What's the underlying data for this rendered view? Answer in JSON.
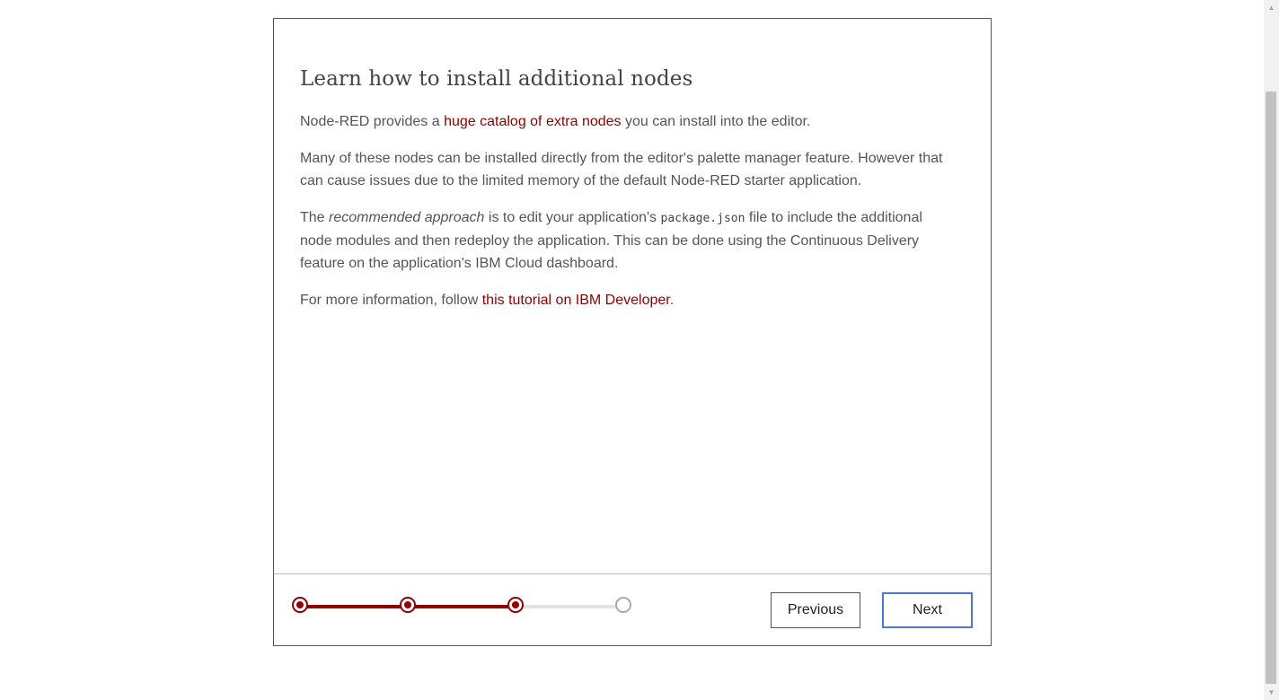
{
  "dialog": {
    "title": "Learn how to install additional nodes",
    "para1": {
      "before": "Node-RED provides a ",
      "link": "huge catalog of extra nodes",
      "after": " you can install into the editor."
    },
    "para2": "Many of these nodes can be installed directly from the editor's palette manager feature. However that can cause issues due to the limited memory of the default Node-RED starter application.",
    "para3": {
      "before": "The ",
      "emphasis": "recommended approach",
      "middle": " is to edit your application's ",
      "code": "package.json",
      "after": " file to include the additional node modules and then redeploy the application. This can be done using the Continuous Delivery feature on the application's IBM Cloud dashboard."
    },
    "para4": {
      "before": "For more information, follow ",
      "link": "this tutorial on IBM Developer",
      "after": "."
    }
  },
  "stepper": {
    "total_steps": 4,
    "current_step": 3
  },
  "buttons": {
    "previous": "Previous",
    "next": "Next"
  },
  "colors": {
    "accent": "#8f0000",
    "text": "#555555",
    "next_border": "#4a78d0"
  },
  "icons": {
    "scroll_up": "▲",
    "scroll_down": "▼"
  }
}
